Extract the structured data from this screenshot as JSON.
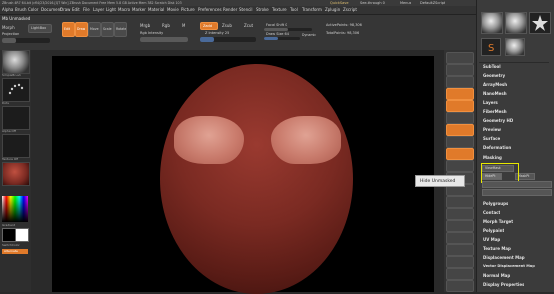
{
  "titlebar": {
    "left_text": "ZBrush 4R7 64-bit (cfl4/23/2016-[QT Win] ZBrush Document  Free Mem 5.8 GB  Active Mem 382  Scratch Disk 103",
    "quicksave": "QuickSave",
    "seethrough": "See-through  0",
    "menus_label": "Menus",
    "script": "DefaultZScript"
  },
  "menubar": {
    "items": [
      "Alpha",
      "Brush",
      "Color",
      "Document",
      "Draw",
      "Edit",
      "File",
      "Layer",
      "Light",
      "Macro",
      "Marker",
      "Material",
      "Movie",
      "Picture",
      "Preferences",
      "Render",
      "Stencil",
      "Stroke",
      "Texture",
      "Tool",
      "Transform",
      "Zplugin",
      "Zscript"
    ]
  },
  "status": "Mb Unmasked",
  "toolbar": {
    "left_top": "Morph",
    "lightbox": "LightBox",
    "rec": "Projection",
    "tools": [
      "Edit",
      "Draw",
      "Move",
      "Scale",
      "Rotate"
    ],
    "mrgb": "Mrgb",
    "rgb": "Rgb",
    "m": "M",
    "rgb_intensity": "Rgb Intensity",
    "zadd": "Zadd",
    "zsub": "Zsub",
    "zcut": "Zcut",
    "z_intensity": "Z Intensity 25",
    "focal_shift": "Focal Shift 0",
    "draw_size": "Draw Size 64",
    "dynamic": "Dynamic",
    "active_points": "ActivePoints: 98,306",
    "total_points": "TotalPoints: 98,306"
  },
  "leftshelf": {
    "labels": [
      "SimpleBrush",
      "Dots",
      "Alpha Off",
      "Texture Off",
      "Gradient",
      "SwitchColor",
      "Alternate"
    ]
  },
  "tooltip": "Hide Unmasked",
  "rightvbar": {
    "buttons": [
      "BPR",
      "SPix 3",
      "Scroll",
      "Zoom",
      "Actual",
      "AAHalf",
      "Persp",
      "Floor",
      "Local",
      "L.Sym",
      "Frame",
      "Move",
      "Scale",
      "Rotate",
      "Line Fill",
      "PolyF",
      "Transp",
      "Ghost",
      "Solo",
      "Xpose"
    ]
  },
  "rightpanel": {
    "tiles": [
      "SimpleBrush",
      "PM3D_Sphere3D",
      "PolyMesh3D",
      "PM3D_Sphere3D_1"
    ],
    "items": [
      "SubTool",
      "Geometry",
      "ArrayMesh",
      "NanoMesh",
      "Layers",
      "FiberMesh",
      "Geometry HD",
      "Preview",
      "Surface",
      "Deformation",
      "Masking"
    ],
    "masking_buttons": [
      "ViewMask",
      "HidePt",
      "MaskPt"
    ],
    "items2": [
      "Polygroups",
      "Contact",
      "Morph Target",
      "Polypaint",
      "UV Map",
      "Texture Map",
      "Displacement Map",
      "Vector Displacement Map",
      "Normal Map",
      "Display Properties"
    ]
  },
  "colors": {
    "accent": "#e07a2a",
    "highlight": "#e8e800",
    "sphere": "#7a2a22"
  }
}
